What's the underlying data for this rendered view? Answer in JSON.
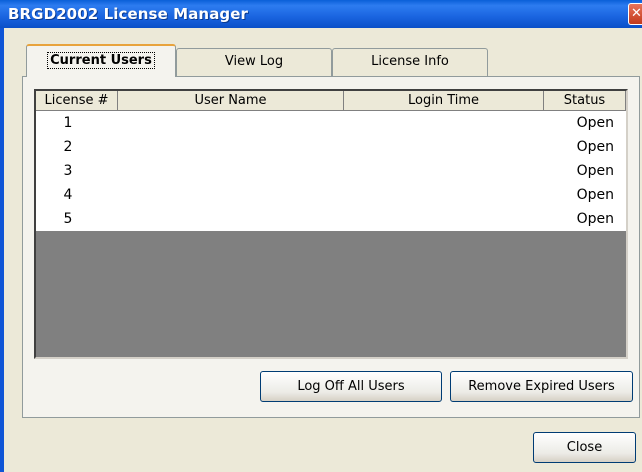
{
  "window": {
    "title": "BRGD2002 License Manager",
    "close_glyph": "✕"
  },
  "tabs": [
    {
      "label": "Current Users",
      "active": true
    },
    {
      "label": "View Log",
      "active": false
    },
    {
      "label": "License Info",
      "active": false
    }
  ],
  "table": {
    "columns": [
      "License #",
      "User Name",
      "Login Time",
      "Status"
    ],
    "rows": [
      {
        "license": "1",
        "user": "",
        "login": "",
        "status": "Open"
      },
      {
        "license": "2",
        "user": "",
        "login": "",
        "status": "Open"
      },
      {
        "license": "3",
        "user": "",
        "login": "",
        "status": "Open"
      },
      {
        "license": "4",
        "user": "",
        "login": "",
        "status": "Open"
      },
      {
        "license": "5",
        "user": "",
        "login": "",
        "status": "Open"
      }
    ]
  },
  "buttons": {
    "log_off_all": "Log Off All Users",
    "remove_expired": "Remove Expired Users",
    "close": "Close"
  }
}
